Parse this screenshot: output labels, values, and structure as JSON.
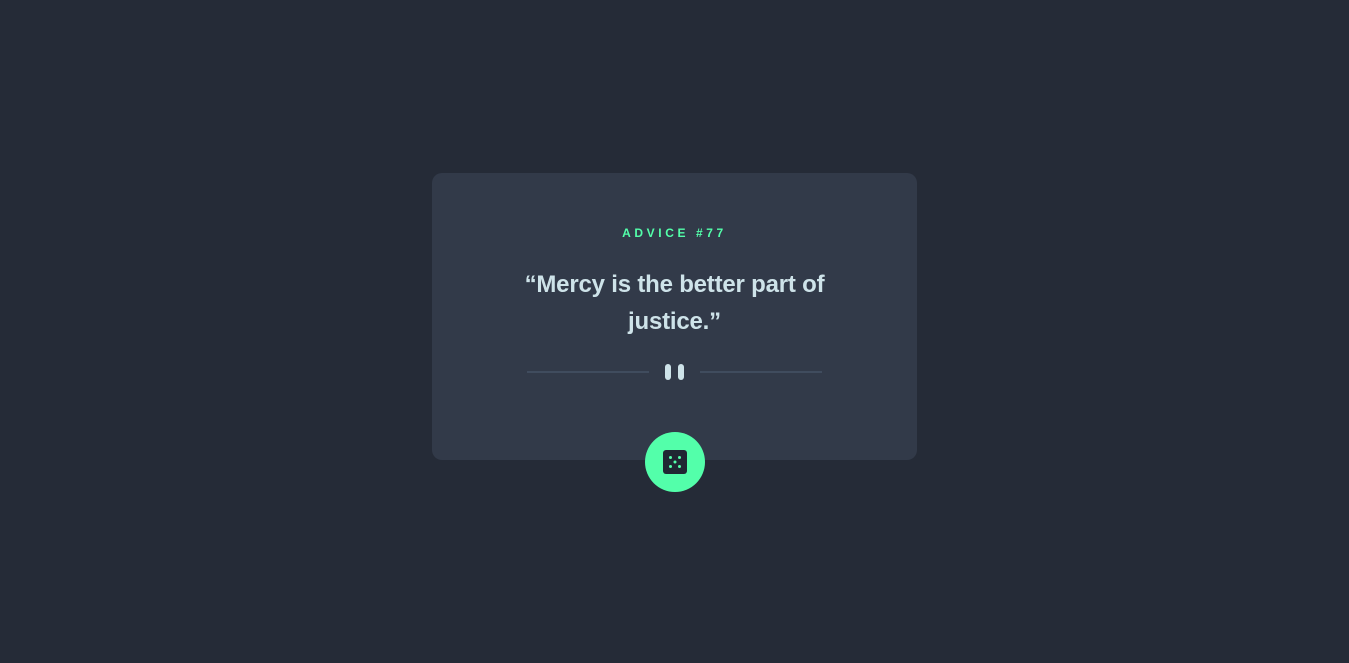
{
  "advice": {
    "label": "ADVICE #77",
    "quote": "“Mercy is the better part of justice.”"
  },
  "icons": {
    "divider": "pause-divider-icon",
    "button": "dice-icon"
  },
  "colors": {
    "background": "#252b37",
    "card": "#323a49",
    "accent": "#53ffaa",
    "text": "#cee3e9",
    "divider": "#4f5d74"
  }
}
